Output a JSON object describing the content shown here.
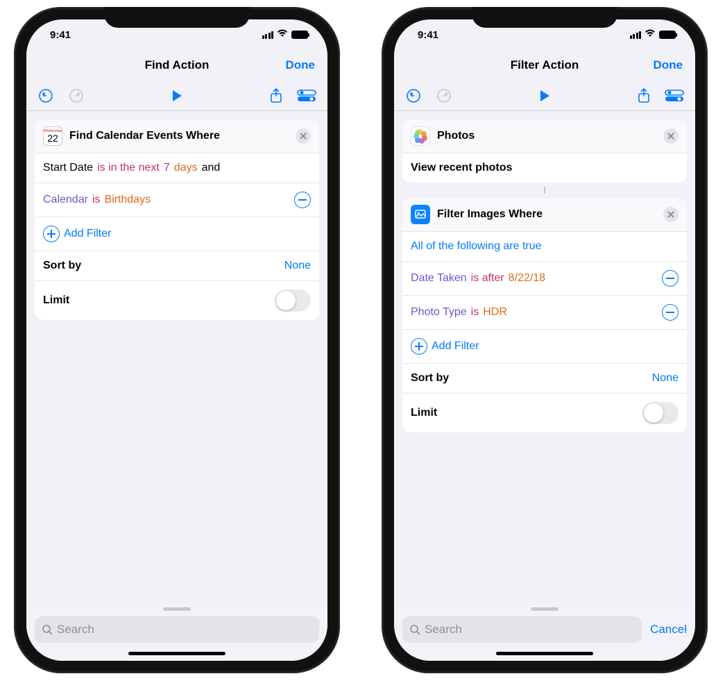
{
  "status": {
    "time": "9:41"
  },
  "phone1": {
    "nav_title": "Find Action",
    "done": "Done",
    "card": {
      "title": "Find Calendar Events Where",
      "filter_line": {
        "field": "Start Date",
        "op": "is in the next",
        "num": "7",
        "unit": "days",
        "conj": "and"
      },
      "filter2": {
        "field": "Calendar",
        "op": "is",
        "value": "Birthdays"
      },
      "add_filter": "Add Filter",
      "sort_label": "Sort by",
      "sort_value": "None",
      "limit_label": "Limit"
    },
    "search_placeholder": "Search"
  },
  "phone2": {
    "nav_title": "Filter Action",
    "done": "Done",
    "photos_card": {
      "title": "Photos",
      "action": "View recent photos"
    },
    "filter_card": {
      "title": "Filter Images Where",
      "scope": "All of the following are true",
      "f1": {
        "field": "Date Taken",
        "op": "is after",
        "value": "8/22/18"
      },
      "f2": {
        "field": "Photo Type",
        "op": "is",
        "value": "HDR"
      },
      "add_filter": "Add Filter",
      "sort_label": "Sort by",
      "sort_value": "None",
      "limit_label": "Limit"
    },
    "search_placeholder": "Search",
    "cancel": "Cancel"
  }
}
